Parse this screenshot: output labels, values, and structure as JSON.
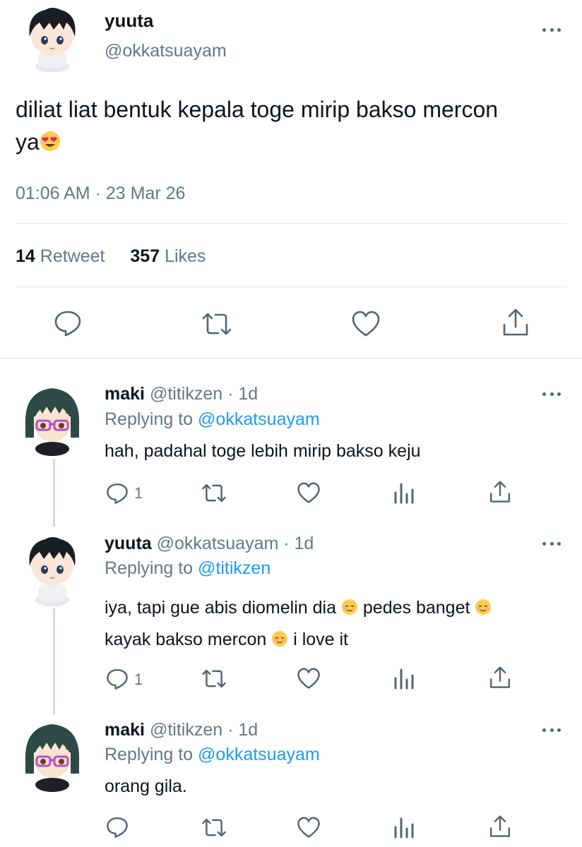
{
  "main_tweet": {
    "author_name": "yuuta",
    "author_handle": "@okkatsuayam",
    "text_line1": "diliat liat bentuk kepala toge mirip bakso mercon",
    "text_line2": "ya",
    "emoji_main": "heart-eyes-emoji",
    "timestamp": "01:06 AM · 23 Mar 26",
    "retweet_count": "14",
    "retweet_label": "Retweet",
    "likes_count": "357",
    "likes_label": "Likes"
  },
  "replies": [
    {
      "name": "maki",
      "handle_time": "@titikzen · 1d",
      "replying_label": "Replying to",
      "replying_to": "@okkatsuayam",
      "text": "hah, padahal toge lebih mirip bakso keju",
      "reply_count": "1"
    },
    {
      "name": "yuuta",
      "handle_time": "@okkatsuayam · 1d",
      "replying_label": "Replying to",
      "replying_to": "@titikzen",
      "text_part1": "iya, tapi gue abis diomelin dia",
      "text_part2": "pedes banget",
      "text_part3": "kayak bakso mercon",
      "text_part4": "i love it",
      "reply_count": "1"
    },
    {
      "name": "maki",
      "handle_time": "@titikzen · 1d",
      "replying_label": "Replying to",
      "replying_to": "@okkatsuayam",
      "text": "orang gila.",
      "reply_count": ""
    }
  ],
  "colors": {
    "accent": "#1d9bf0",
    "muted": "#657786",
    "divider": "#e1e4e8"
  }
}
